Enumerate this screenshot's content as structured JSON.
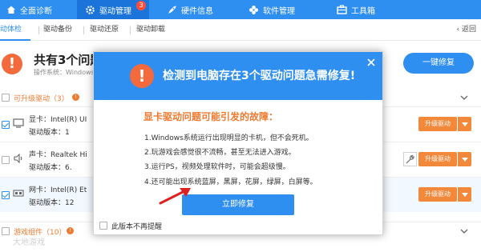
{
  "nav": {
    "items": [
      {
        "label": "全面诊断",
        "icon": "house-icon"
      },
      {
        "label": "驱动管理",
        "icon": "gear-icon",
        "badge": "3"
      },
      {
        "label": "硬件信息",
        "icon": "rocket-icon"
      },
      {
        "label": "软件管理",
        "icon": "clover-icon"
      },
      {
        "label": "工具箱",
        "icon": "toolbox-icon"
      }
    ],
    "active_index": 1
  },
  "subtabs": {
    "items": [
      "动体检",
      "驱动备份",
      "驱动还原",
      "驱动卸载"
    ],
    "back": "返回"
  },
  "summary": {
    "title": "共有3个问题",
    "os": "操作系统：Windows",
    "fix_all": "一键修复"
  },
  "sections": {
    "upgradable": {
      "label": "可升级驱动（3）"
    },
    "games": {
      "label": "游戏组件（10）"
    }
  },
  "rows": [
    {
      "name": "显卡：Intel(R) UI",
      "version": "驱动版本：1",
      "button": "升级驱动",
      "icon": "monitor-icon",
      "checked": true
    },
    {
      "name": "声卡：Realtek Hi",
      "version": "驱动版本：6.",
      "button": "升级驱动",
      "icon": "speaker-icon",
      "checked": false
    },
    {
      "name": "网卡：Intel(R) Et",
      "version": "驱动版本：12",
      "button": "升级驱动",
      "icon": "network-icon",
      "checked": true
    }
  ],
  "watermark": "大地游戏",
  "modal": {
    "title": "检测到电脑存在3个驱动问题急需修复!",
    "subtitle": "显卡驱动问题可能引发的故障：",
    "reasons": [
      "1.Windows系统运行出现明显的卡机，但不会死机。",
      "2.玩游戏会感觉很不流畅，甚至无法进入游戏。",
      "3.运行PS，视频处理软件时，可能会超级慢。",
      "4.还可能出现系统蓝屏，黑屏，花屏，绿屏，白屏等。"
    ],
    "fix_now": "立即修复",
    "dont_remind": "此版本不再提醒"
  },
  "colors": {
    "primary": "#2f8ff0",
    "orange": "#f2883a",
    "alert": "#f36a3d"
  }
}
